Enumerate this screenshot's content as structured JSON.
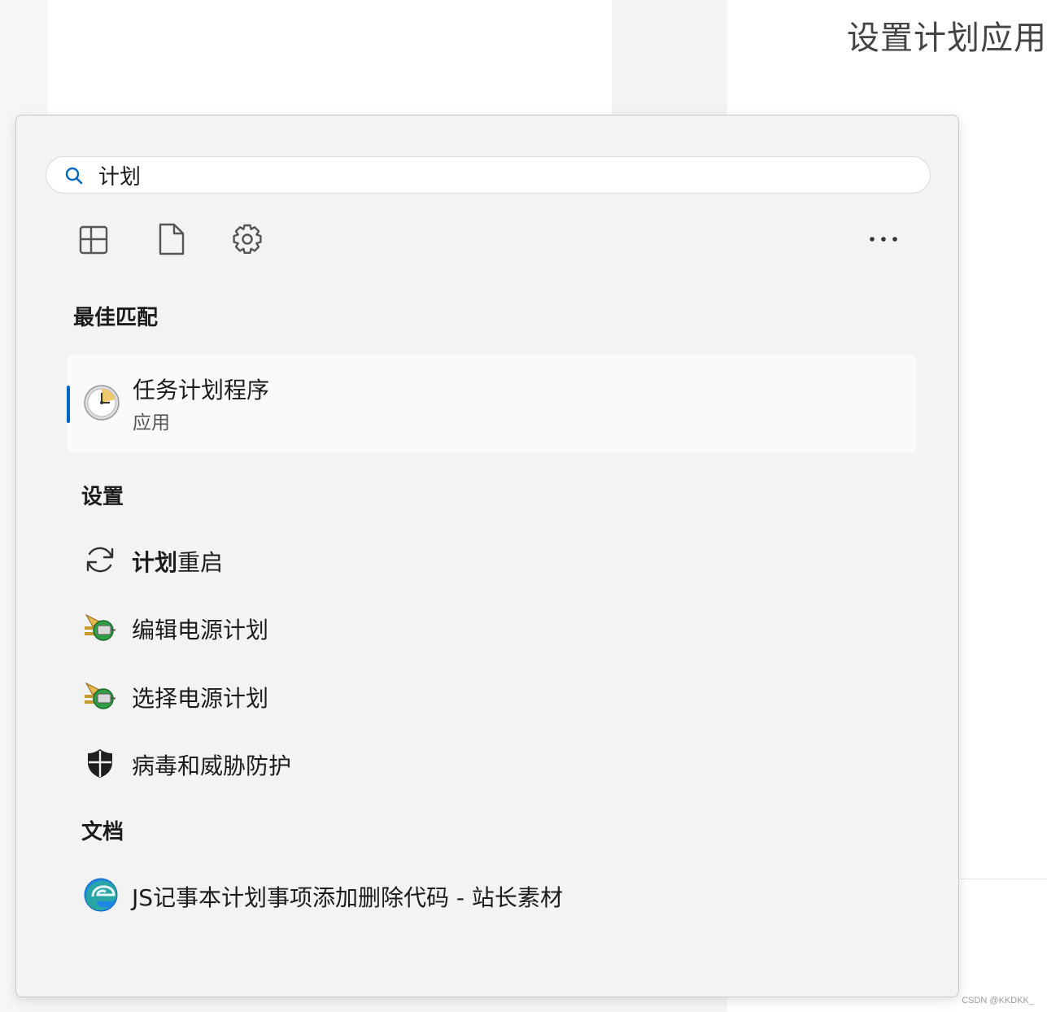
{
  "background": {
    "title": "设置计划应用"
  },
  "watermark": "CSDN @KKDKK_",
  "search": {
    "query": "计划",
    "icon": "search-icon"
  },
  "filters": [
    {
      "name": "apps-filter",
      "icon": "apps-grid-icon"
    },
    {
      "name": "documents-filter",
      "icon": "document-icon"
    },
    {
      "name": "settings-filter",
      "icon": "gear-icon"
    }
  ],
  "more_icon": "more-options-icon",
  "sections": {
    "best_match": "最佳匹配",
    "settings": "设置",
    "documents": "文档"
  },
  "best_match": {
    "title": "任务计划程序",
    "subtitle": "应用",
    "icon": "task-scheduler-clock-icon"
  },
  "settings_items": [
    {
      "highlight": "计划",
      "rest": "重启",
      "icon": "refresh-icon"
    },
    {
      "label": "编辑电源计划",
      "icon": "power-plan-icon"
    },
    {
      "label": "选择电源计划",
      "icon": "power-plan-icon"
    },
    {
      "label": "病毒和威胁防护",
      "icon": "shield-icon"
    }
  ],
  "document_items": [
    {
      "label": "JS记事本计划事项添加删除代码 - 站长素材",
      "icon": "edge-browser-icon"
    }
  ],
  "colors": {
    "accent": "#0067c0",
    "panel_bg": "#f3f3f3"
  }
}
